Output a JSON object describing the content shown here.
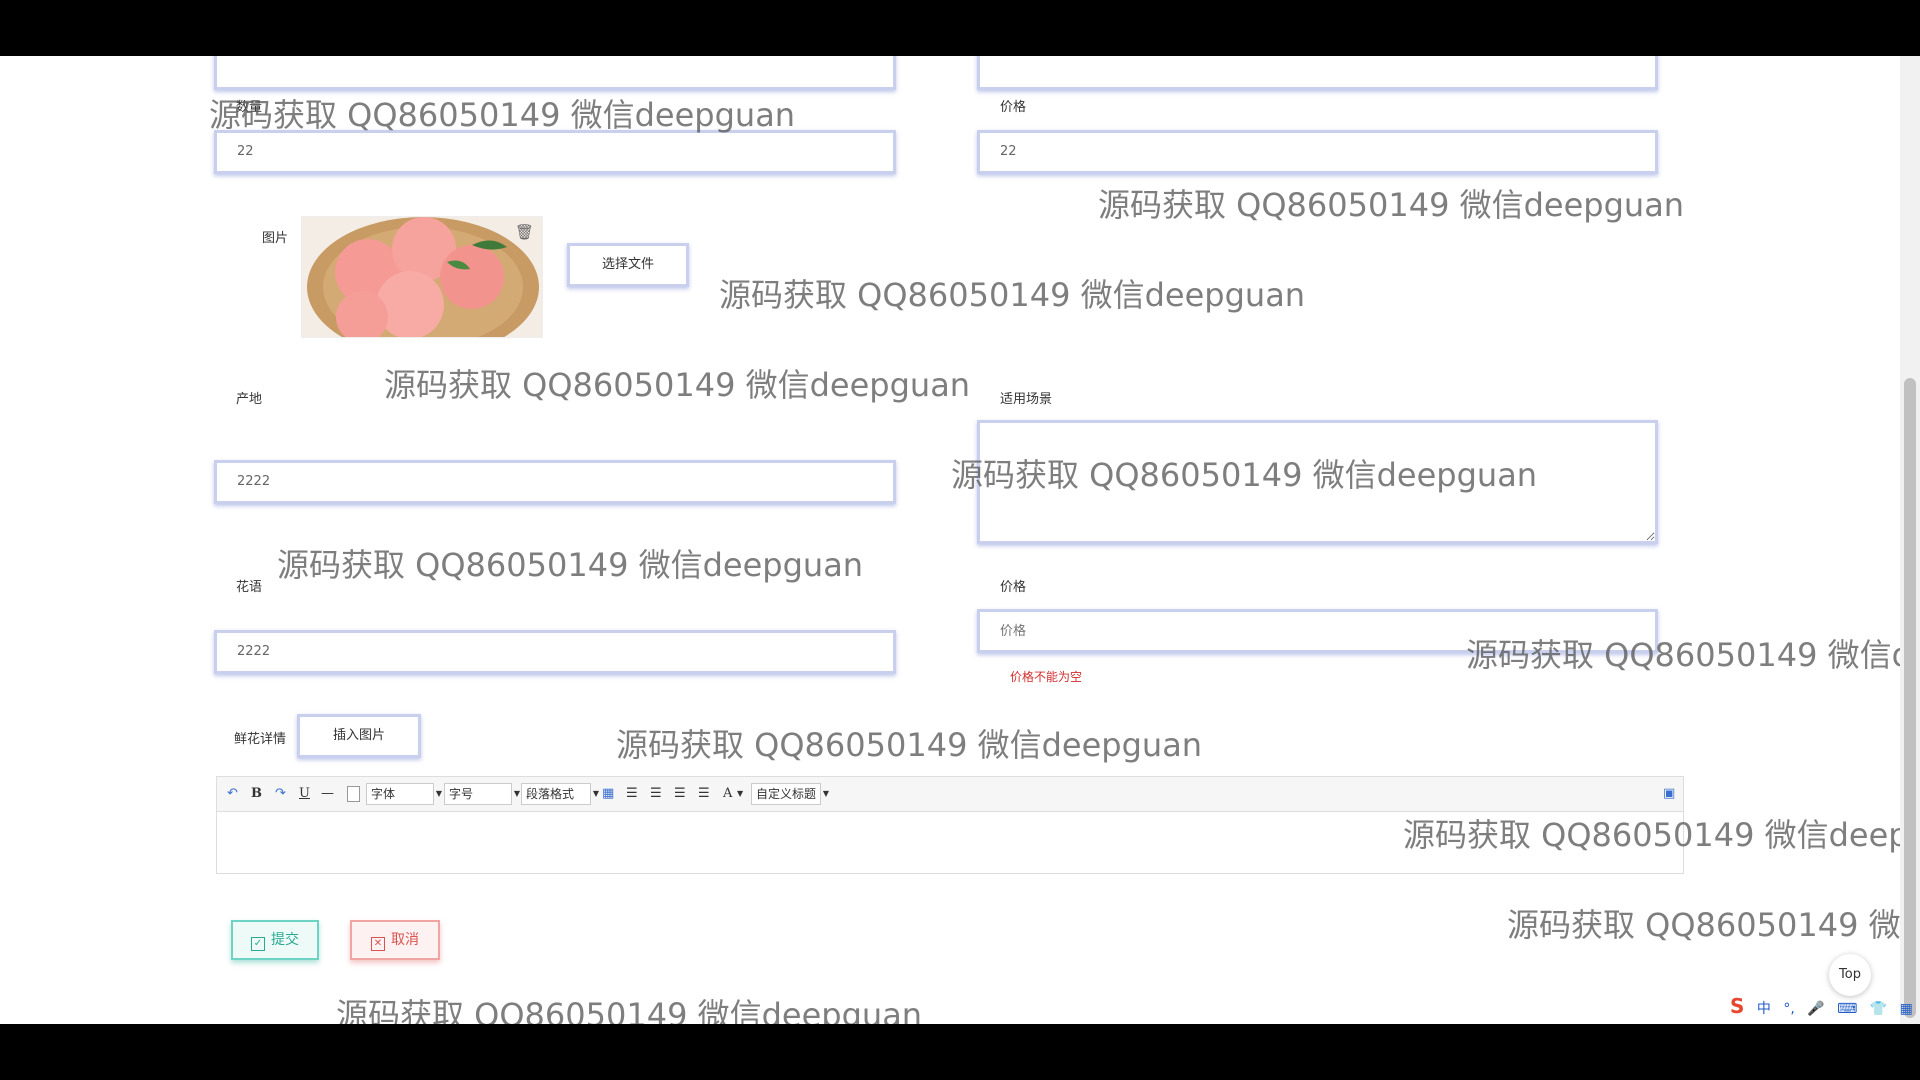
{
  "form": {
    "quantity": {
      "label": "数量",
      "value": "22"
    },
    "price": {
      "label": "价格",
      "value": "22"
    },
    "image": {
      "label": "图片",
      "choose_file": "选择文件"
    },
    "origin": {
      "label": "产地",
      "value": "2222"
    },
    "scenario": {
      "label": "适用场景",
      "value": ""
    },
    "flower_language": {
      "label": "花语",
      "value": "2222"
    },
    "price2": {
      "label": "价格",
      "placeholder": "价格",
      "error": "价格不能为空"
    },
    "detail": {
      "label": "鲜花详情",
      "insert_image": "插入图片"
    }
  },
  "editor": {
    "toolbar": {
      "undo": "↶",
      "bold": "B",
      "redo": "↷",
      "underline": "U",
      "hr": "—",
      "font": "字体",
      "size": "字号",
      "paragraph": "段落格式",
      "font_color": "A",
      "custom_title": "自定义标题"
    }
  },
  "actions": {
    "submit": "提交",
    "cancel": "取消"
  },
  "top_button": "Top",
  "watermark": "源码获取 QQ86050149 微信deepguan",
  "ime": {
    "logo": "S",
    "lang": "中",
    "punct": "°,",
    "mic": "🎤",
    "keyboard": "⌨",
    "skin": "👕",
    "grid": "▦"
  },
  "colors": {
    "field_border": "#c8d0ee",
    "error": "#d32f2f",
    "submit": "#2ba993",
    "cancel": "#d9534f"
  }
}
